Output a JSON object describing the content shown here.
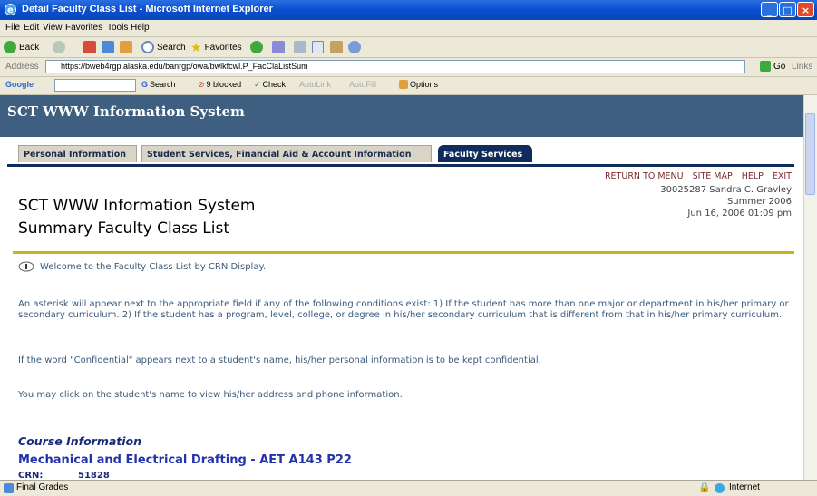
{
  "window": {
    "title": "Detail Faculty Class List - Microsoft Internet Explorer"
  },
  "menu": [
    "File",
    "Edit",
    "View",
    "Favorites",
    "Tools",
    "Help"
  ],
  "toolbar": {
    "back": "Back",
    "search": "Search",
    "favorites": "Favorites"
  },
  "address": {
    "label": "Address",
    "url": "https://bweb4rgp.alaska.edu/banrgp/owa/bwlkfcwl.P_FacClaListSum",
    "go": "Go",
    "links": "Links"
  },
  "google": {
    "brand": "Google",
    "search": "Search",
    "blocked": "9 blocked",
    "check": "Check",
    "autolink": "AutoLink",
    "autofill": "AutoFill",
    "options": "Options"
  },
  "banner": {
    "title": "SCT WWW Information System"
  },
  "tabs": [
    {
      "label": "Personal Information",
      "active": false
    },
    {
      "label": "Student Services, Financial Aid & Account Information",
      "active": false
    },
    {
      "label": "Faculty Services",
      "active": true
    }
  ],
  "toplinks": {
    "return_menu": "RETURN TO MENU",
    "site_map": "SITE MAP",
    "help": "HELP",
    "exit": "EXIT"
  },
  "user_info": {
    "id_name": "30025287 Sandra C. Gravley",
    "term": "Summer 2006",
    "datetime": "Jun 16, 2006 01:09 pm"
  },
  "page": {
    "title_line1": "SCT WWW Information System",
    "title_line2": "Summary Faculty Class List",
    "welcome": "Welcome to the Faculty Class List by CRN Display.",
    "para1": "An asterisk will appear next to the appropriate field if any of the following conditions exist: 1) If the student has more than one major or department in his/her primary or secondary curriculum. 2) If the student has a program, level, college, or degree in his/her secondary curriculum that is different from that in his/her primary curriculum.",
    "para2": "If the word \"Confidential\" appears next to a student's name, his/her personal information is to be kept confidential.",
    "para3": "You may click on the student's name to view his/her address and phone information.",
    "course_heading": "Course Information",
    "course_title": "Mechanical and Electrical Drafting - AET A143 P22",
    "crn_label": "CRN:",
    "crn_value": "51828"
  },
  "status": {
    "left": "Final Grades",
    "zone": "Internet"
  },
  "colors": {
    "banner": "#3e5f7f",
    "tab_active": "#0f2c5c",
    "gold_rule": "#c7b31a",
    "link": "#7a2a2a",
    "body_text": "#3a5a7a",
    "course": "#2233aa"
  }
}
